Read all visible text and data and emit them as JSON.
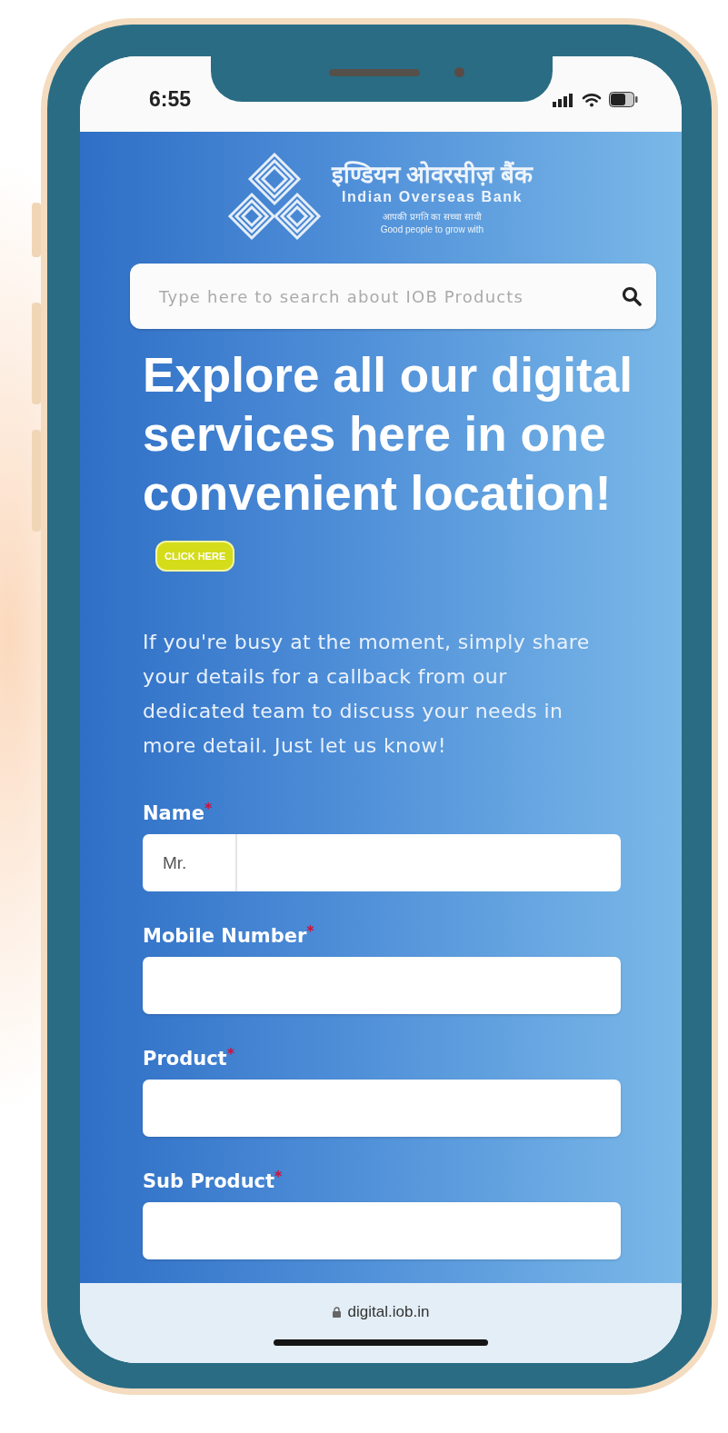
{
  "status_bar": {
    "time": "6:55"
  },
  "header": {
    "bank_name_hindi": "इण्डियन ओवरसीज़ बैंक",
    "bank_name": "Indian Overseas Bank",
    "tagline_hindi": "आपकी प्रगति का सच्चा साथी",
    "tagline": "Good people to grow with"
  },
  "search": {
    "placeholder": "Type here to search about IOB Products"
  },
  "heading": {
    "text": "Explore all our digital services here in one convenient location!",
    "badge": "CLICK HERE"
  },
  "intro": "If you're busy at the moment, simply share your details for a callback from our dedicated team to discuss your needs in more detail. Just let us know!",
  "form": {
    "fields": [
      {
        "label": "Name",
        "required_mark": "*",
        "kind": "name",
        "title_value": "Mr."
      },
      {
        "label": "Mobile Number",
        "required_mark": "*",
        "kind": "text"
      },
      {
        "label": "Product",
        "required_mark": "*",
        "kind": "text"
      },
      {
        "label": "Sub Product",
        "required_mark": "*",
        "kind": "text"
      }
    ]
  },
  "browser_bar": {
    "url": "digital.iob.in"
  }
}
